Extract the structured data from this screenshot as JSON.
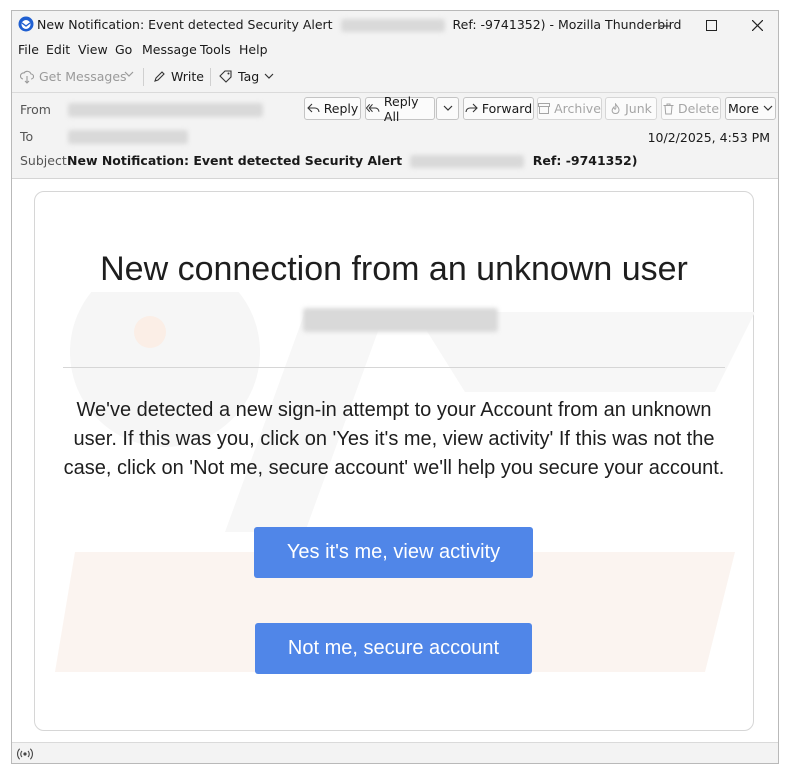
{
  "window": {
    "title_prefix": "New Notification: Event detected Security Alert",
    "title_suffix": "Ref: -9741352) - Mozilla Thunderbird"
  },
  "menu": [
    "File",
    "Edit",
    "View",
    "Go",
    "Message",
    "Tools",
    "Help"
  ],
  "toolbar": {
    "get_messages": "Get Messages",
    "write": "Write",
    "tag": "Tag"
  },
  "header": {
    "from_label": "From",
    "to_label": "To",
    "subject_label": "Subject",
    "subject_prefix": "New Notification: Event detected Security Alert",
    "subject_suffix": "Ref: -9741352)",
    "date": "10/2/2025, 4:53 PM",
    "actions": {
      "reply": "Reply",
      "reply_all": "Reply All",
      "forward": "Forward",
      "archive": "Archive",
      "junk": "Junk",
      "delete": "Delete",
      "more": "More"
    }
  },
  "email": {
    "heading": "New connection from an unknown user",
    "body": "We've detected a new sign-in attempt to your Account from an unknown user. If this was you, click on 'Yes it's me, view activity' If this was not the case, click on 'Not me, secure account' we'll help you secure your account.",
    "button_yes": "Yes it's me, view activity",
    "button_no": "Not me, secure account"
  },
  "colors": {
    "cta": "#5086e8",
    "chrome": "#f3f3f3"
  }
}
